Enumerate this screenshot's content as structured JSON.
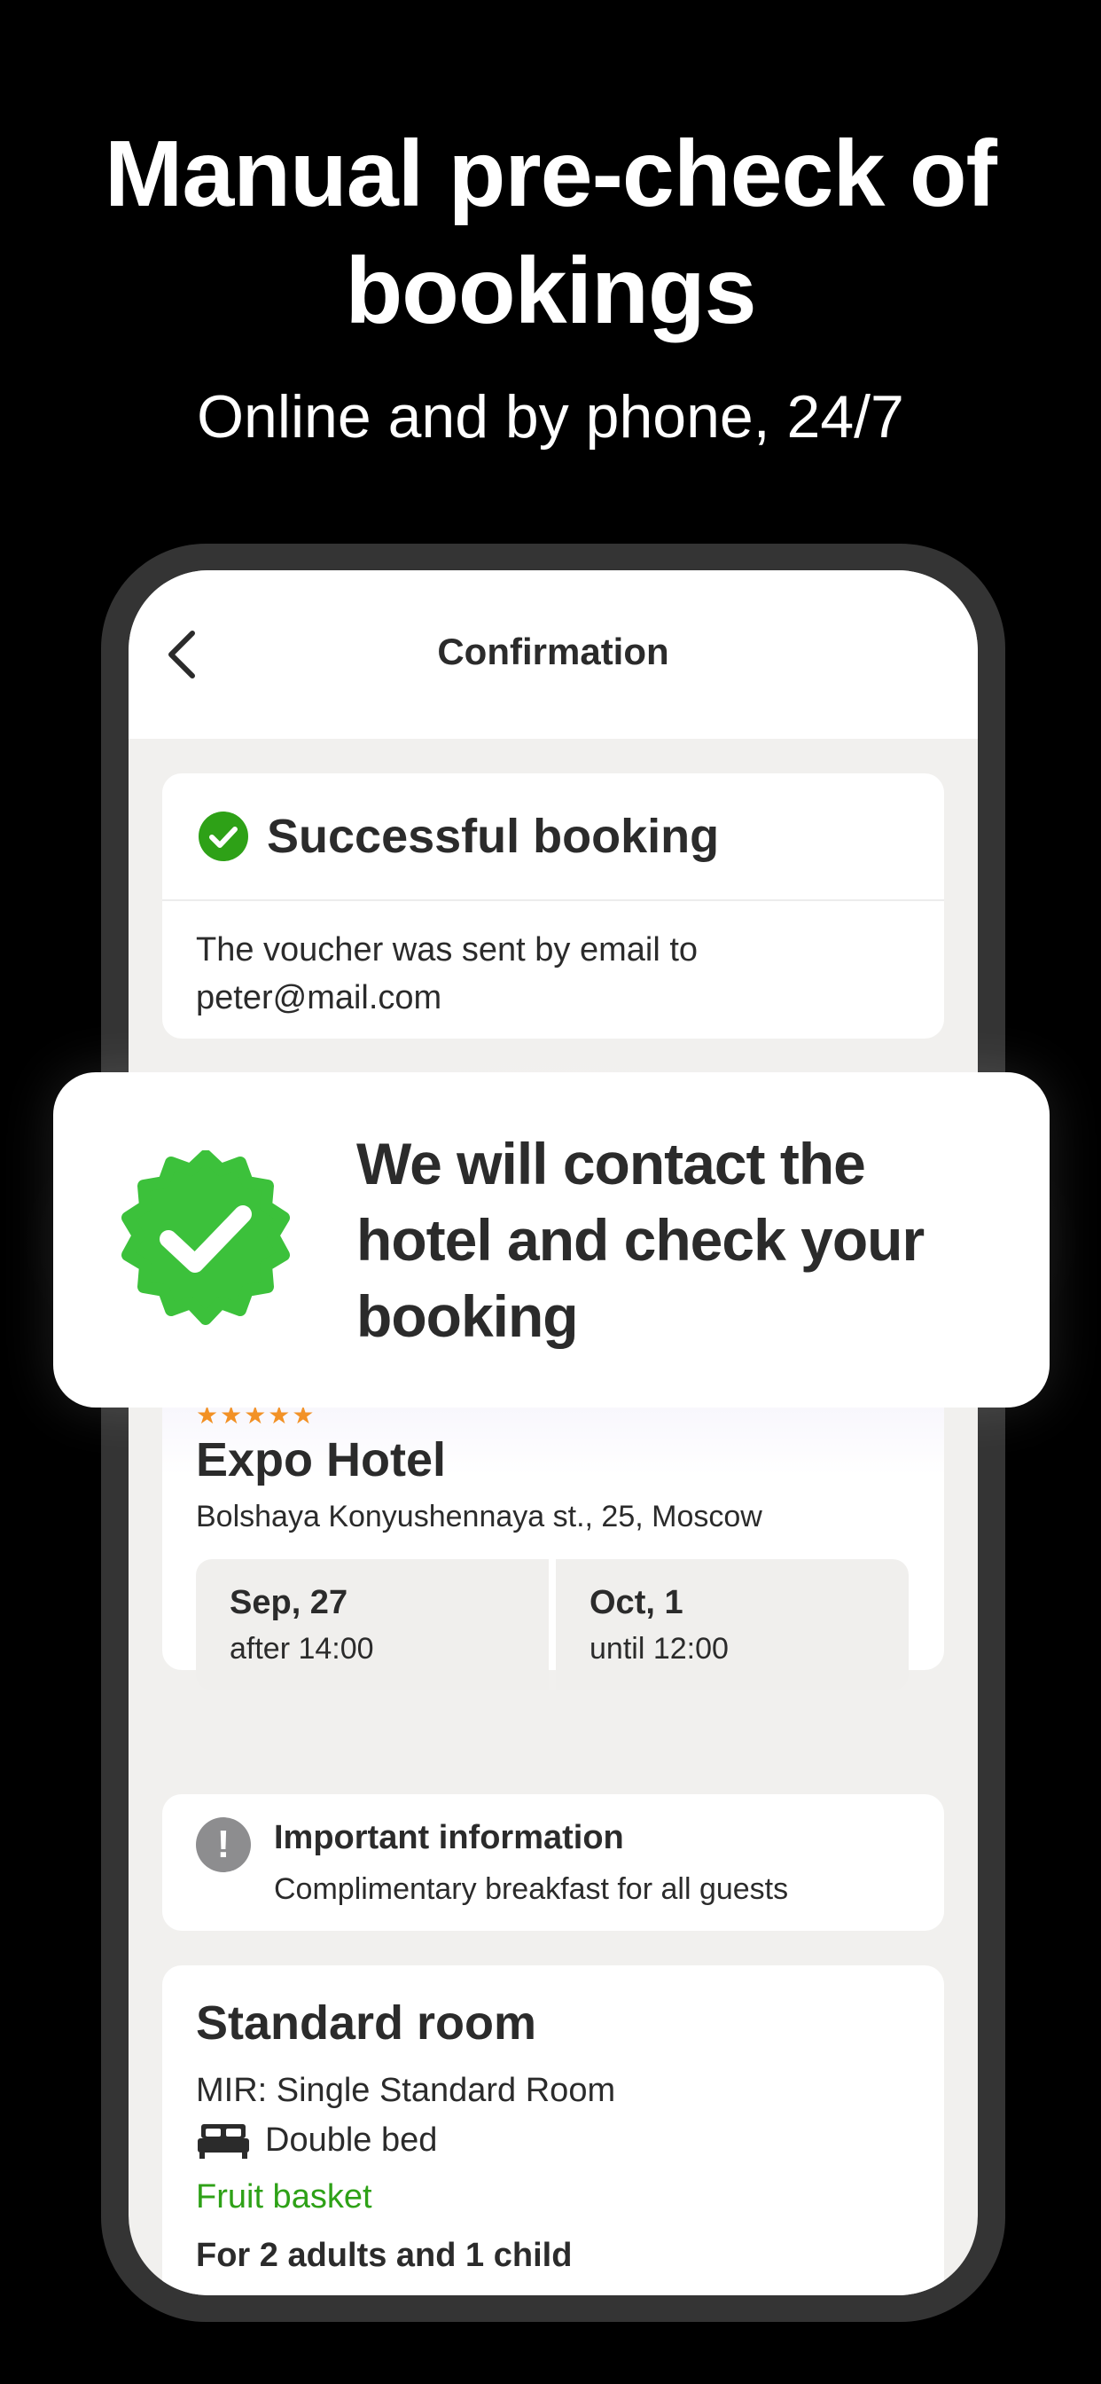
{
  "promo": {
    "headline": "Manual pre-check of bookings",
    "subheadline": "Online and by phone, 24/7"
  },
  "navbar": {
    "title": "Confirmation"
  },
  "success_card": {
    "title": "Successful booking",
    "message": "The voucher was sent by email to peter@mail.com"
  },
  "overlay": {
    "text": "We will contact the hotel and check your booking"
  },
  "hotel": {
    "stars": "★★★★★",
    "star_count": 5,
    "name": "Expo Hotel",
    "address": "Bolshaya Konyushennaya st., 25, Moscow",
    "check_in": {
      "date": "Sep, 27",
      "time": "after 14:00"
    },
    "check_out": {
      "date": "Oct, 1",
      "time": "until 12:00"
    }
  },
  "important_info": {
    "title": "Important information",
    "text": "Complimentary breakfast for all guests"
  },
  "room": {
    "title": "Standard room",
    "type": "MIR: Single Standard Room",
    "bed": "Double bed",
    "extra": "Fruit basket",
    "guests": "For 2 adults and 1 child"
  },
  "icons": {
    "back": "chevron-left-icon",
    "success": "check-circle-icon",
    "badge": "verified-badge-icon",
    "info": "exclamation-icon",
    "bed": "bed-icon"
  },
  "colors": {
    "background": "#000000",
    "success_green": "#2ea117",
    "badge_green": "#3cc13b",
    "star_orange": "#f28c1b",
    "text_dark": "#2b2b2b",
    "info_gray": "#8d8d8f",
    "screen_bg": "#f1f0ee"
  }
}
